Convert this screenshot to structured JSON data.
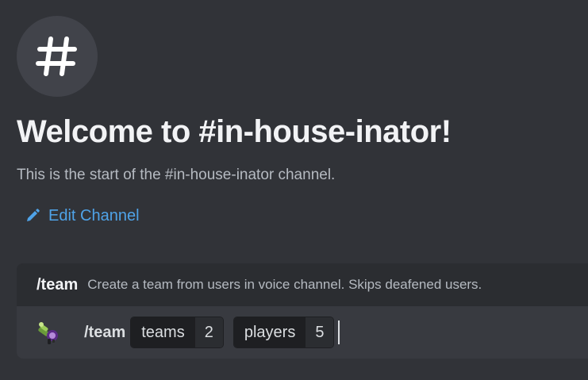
{
  "icons": {
    "channel": "hashtag-icon",
    "edit": "pencil-icon",
    "bot": "bot-avatar"
  },
  "colors": {
    "background": "#313338",
    "link": "#4fa3e8",
    "panel": "#2b2d31",
    "input_row": "#383a40"
  },
  "welcome": {
    "title": "Welcome to #in-house-inator!",
    "subtitle": "This is the start of the #in-house-inator channel.",
    "edit_label": "Edit Channel"
  },
  "command": {
    "header_name": "/team",
    "description": "Create a team from users in voice channel. Skips deafened users.",
    "input_name": "/team",
    "options": [
      {
        "name": "teams",
        "value": "2"
      },
      {
        "name": "players",
        "value": "5"
      }
    ]
  }
}
